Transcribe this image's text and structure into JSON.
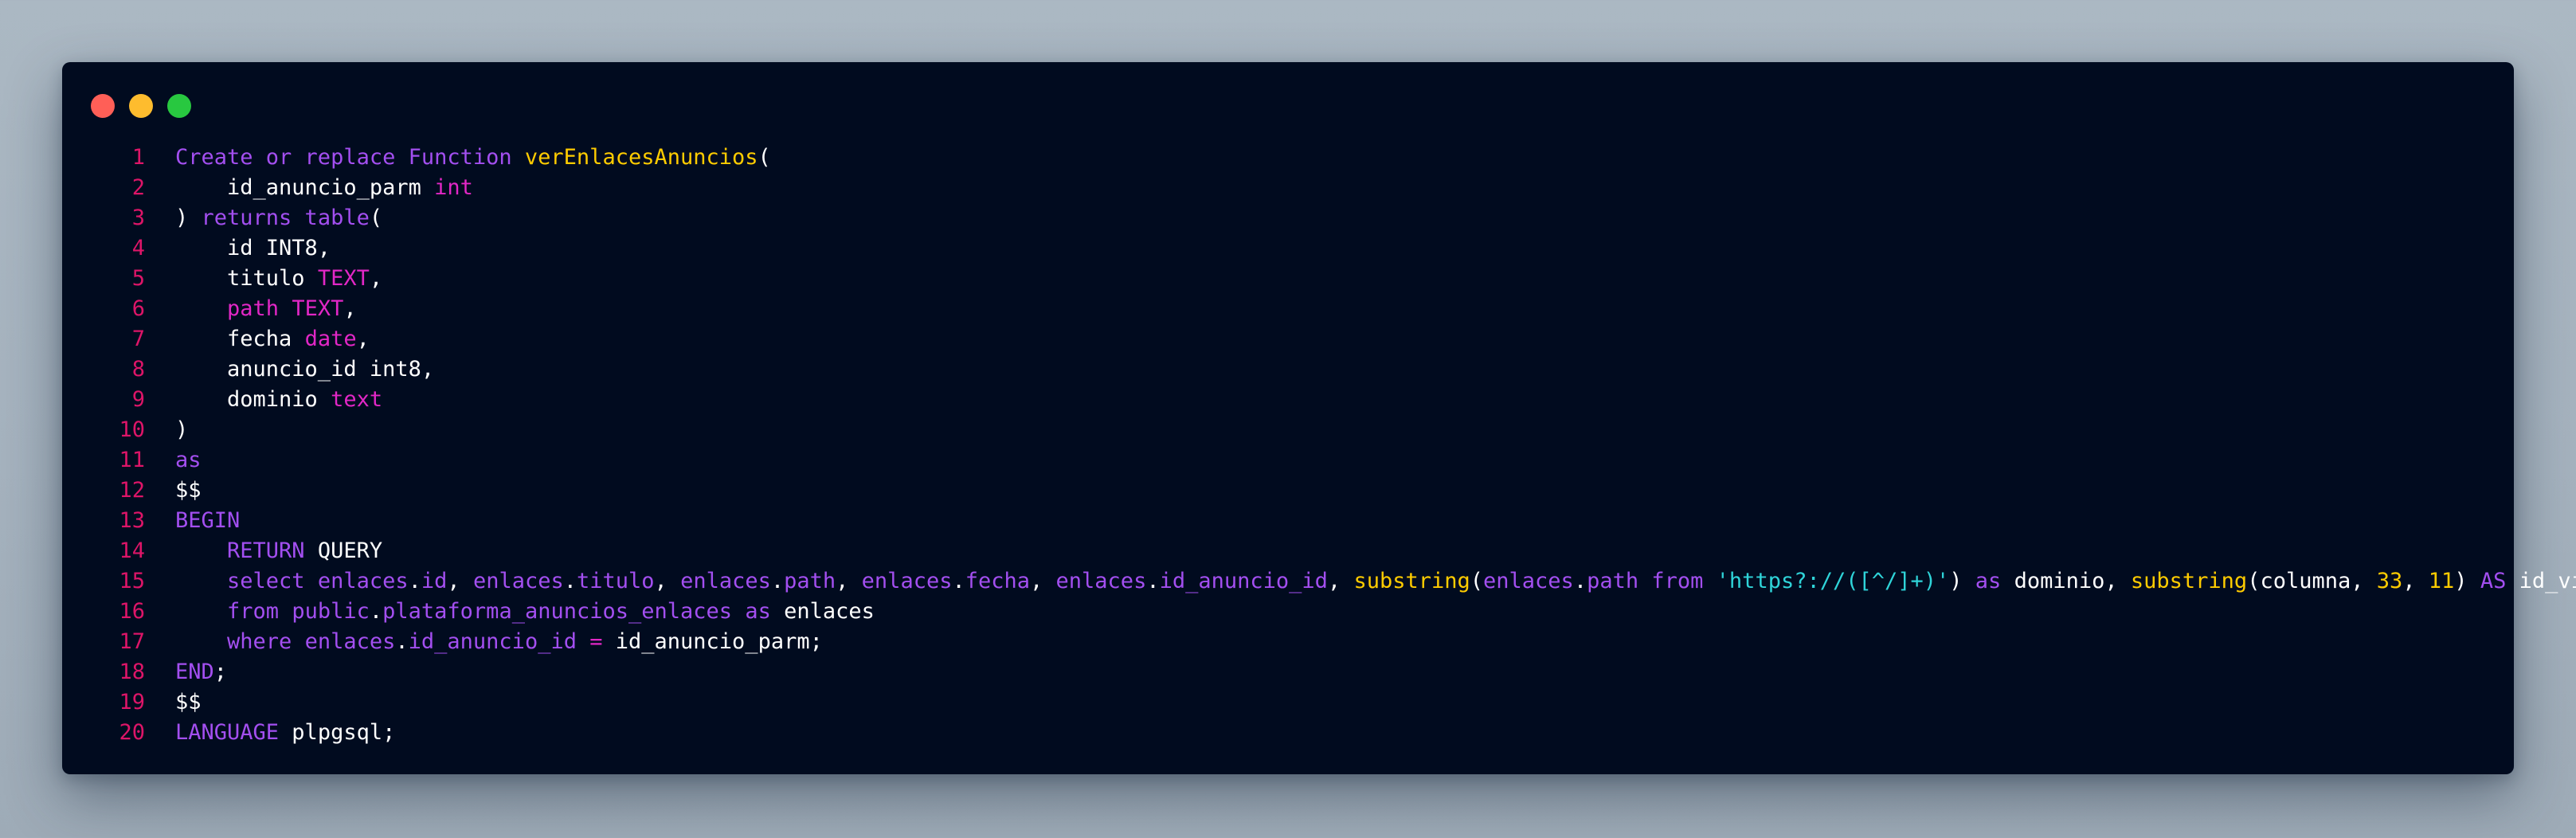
{
  "window": {
    "controls": [
      {
        "name": "close",
        "color": "#ff5f57"
      },
      {
        "name": "minimize",
        "color": "#febc2e"
      },
      {
        "name": "zoom",
        "color": "#28c840"
      }
    ]
  },
  "theme": {
    "background": "#010b1f",
    "keyword": "#a34ff0",
    "function": "#ffcc00",
    "type": "#e227c6",
    "plain": "#ffffff",
    "number": "#ffcc00",
    "string": "#2fd4d9",
    "line_number": "#dd1568"
  },
  "code": {
    "lines": [
      {
        "n": "1",
        "tokens": [
          {
            "t": "Create or replace Function ",
            "c": "kw"
          },
          {
            "t": "verEnlacesAnuncios",
            "c": "fn"
          },
          {
            "t": "(",
            "c": "pl"
          }
        ]
      },
      {
        "n": "2",
        "tokens": [
          {
            "t": "    id_anuncio_parm ",
            "c": "pl"
          },
          {
            "t": "int",
            "c": "ty"
          }
        ]
      },
      {
        "n": "3",
        "tokens": [
          {
            "t": ") ",
            "c": "pl"
          },
          {
            "t": "returns table",
            "c": "kw"
          },
          {
            "t": "(",
            "c": "pl"
          }
        ]
      },
      {
        "n": "4",
        "tokens": [
          {
            "t": "    id INT8,",
            "c": "pl"
          }
        ]
      },
      {
        "n": "5",
        "tokens": [
          {
            "t": "    titulo ",
            "c": "pl"
          },
          {
            "t": "TEXT",
            "c": "ty"
          },
          {
            "t": ",",
            "c": "pl"
          }
        ]
      },
      {
        "n": "6",
        "tokens": [
          {
            "t": "    ",
            "c": "pl"
          },
          {
            "t": "path",
            "c": "ty"
          },
          {
            "t": " ",
            "c": "pl"
          },
          {
            "t": "TEXT",
            "c": "ty"
          },
          {
            "t": ",",
            "c": "pl"
          }
        ]
      },
      {
        "n": "7",
        "tokens": [
          {
            "t": "    fecha ",
            "c": "pl"
          },
          {
            "t": "date",
            "c": "ty"
          },
          {
            "t": ",",
            "c": "pl"
          }
        ]
      },
      {
        "n": "8",
        "tokens": [
          {
            "t": "    anuncio_id int8,",
            "c": "pl"
          }
        ]
      },
      {
        "n": "9",
        "tokens": [
          {
            "t": "    dominio ",
            "c": "pl"
          },
          {
            "t": "text",
            "c": "ty"
          }
        ]
      },
      {
        "n": "10",
        "tokens": [
          {
            "t": ")",
            "c": "pl"
          }
        ]
      },
      {
        "n": "11",
        "tokens": [
          {
            "t": "as",
            "c": "kw"
          }
        ]
      },
      {
        "n": "12",
        "tokens": [
          {
            "t": "$$",
            "c": "pl"
          }
        ]
      },
      {
        "n": "13",
        "tokens": [
          {
            "t": "BEGIN",
            "c": "kw"
          }
        ]
      },
      {
        "n": "14",
        "tokens": [
          {
            "t": "    ",
            "c": "pl"
          },
          {
            "t": "RETURN",
            "c": "kw"
          },
          {
            "t": " QUERY",
            "c": "pl"
          }
        ]
      },
      {
        "n": "15",
        "tokens": [
          {
            "t": "    ",
            "c": "pl"
          },
          {
            "t": "select",
            "c": "kw"
          },
          {
            "t": " ",
            "c": "pl"
          },
          {
            "t": "enlaces",
            "c": "pr"
          },
          {
            "t": ".",
            "c": "pl"
          },
          {
            "t": "id",
            "c": "pr"
          },
          {
            "t": ", ",
            "c": "pl"
          },
          {
            "t": "enlaces",
            "c": "pr"
          },
          {
            "t": ".",
            "c": "pl"
          },
          {
            "t": "titulo",
            "c": "pr"
          },
          {
            "t": ", ",
            "c": "pl"
          },
          {
            "t": "enlaces",
            "c": "pr"
          },
          {
            "t": ".",
            "c": "pl"
          },
          {
            "t": "path",
            "c": "pr"
          },
          {
            "t": ", ",
            "c": "pl"
          },
          {
            "t": "enlaces",
            "c": "pr"
          },
          {
            "t": ".",
            "c": "pl"
          },
          {
            "t": "fecha",
            "c": "pr"
          },
          {
            "t": ", ",
            "c": "pl"
          },
          {
            "t": "enlaces",
            "c": "pr"
          },
          {
            "t": ".",
            "c": "pl"
          },
          {
            "t": "id_anuncio_id",
            "c": "pr"
          },
          {
            "t": ", ",
            "c": "pl"
          },
          {
            "t": "substring",
            "c": "fn"
          },
          {
            "t": "(",
            "c": "pl"
          },
          {
            "t": "enlaces",
            "c": "pr"
          },
          {
            "t": ".",
            "c": "pl"
          },
          {
            "t": "path",
            "c": "pr"
          },
          {
            "t": " ",
            "c": "pl"
          },
          {
            "t": "from",
            "c": "kw"
          },
          {
            "t": " ",
            "c": "pl"
          },
          {
            "t": "'https?://([^/]+)'",
            "c": "st"
          },
          {
            "t": ") ",
            "c": "pl"
          },
          {
            "t": "as",
            "c": "kw"
          },
          {
            "t": " dominio, ",
            "c": "pl"
          },
          {
            "t": "substring",
            "c": "fn"
          },
          {
            "t": "(columna, ",
            "c": "pl"
          },
          {
            "t": "33",
            "c": "nm"
          },
          {
            "t": ", ",
            "c": "pl"
          },
          {
            "t": "11",
            "c": "nm"
          },
          {
            "t": ") ",
            "c": "pl"
          },
          {
            "t": "AS",
            "c": "kw"
          },
          {
            "t": " id_video",
            "c": "pl"
          }
        ]
      },
      {
        "n": "16",
        "tokens": [
          {
            "t": "    ",
            "c": "pl"
          },
          {
            "t": "from",
            "c": "kw"
          },
          {
            "t": " ",
            "c": "pl"
          },
          {
            "t": "public",
            "c": "pr"
          },
          {
            "t": ".",
            "c": "pl"
          },
          {
            "t": "plataforma_anuncios_enlaces",
            "c": "pr"
          },
          {
            "t": " ",
            "c": "pl"
          },
          {
            "t": "as",
            "c": "kw"
          },
          {
            "t": " enlaces",
            "c": "pl"
          }
        ]
      },
      {
        "n": "17",
        "tokens": [
          {
            "t": "    ",
            "c": "pl"
          },
          {
            "t": "where",
            "c": "kw"
          },
          {
            "t": " ",
            "c": "pl"
          },
          {
            "t": "enlaces",
            "c": "pr"
          },
          {
            "t": ".",
            "c": "pl"
          },
          {
            "t": "id_anuncio_id",
            "c": "pr"
          },
          {
            "t": " ",
            "c": "pl"
          },
          {
            "t": "=",
            "c": "ty"
          },
          {
            "t": " id_anuncio_parm;",
            "c": "pl"
          }
        ]
      },
      {
        "n": "18",
        "tokens": [
          {
            "t": "END",
            "c": "kw"
          },
          {
            "t": ";",
            "c": "pl"
          }
        ]
      },
      {
        "n": "19",
        "tokens": [
          {
            "t": "$$",
            "c": "pl"
          }
        ]
      },
      {
        "n": "20",
        "tokens": [
          {
            "t": "LANGUAGE",
            "c": "kw"
          },
          {
            "t": " plpgsql;",
            "c": "pl"
          }
        ]
      }
    ]
  }
}
